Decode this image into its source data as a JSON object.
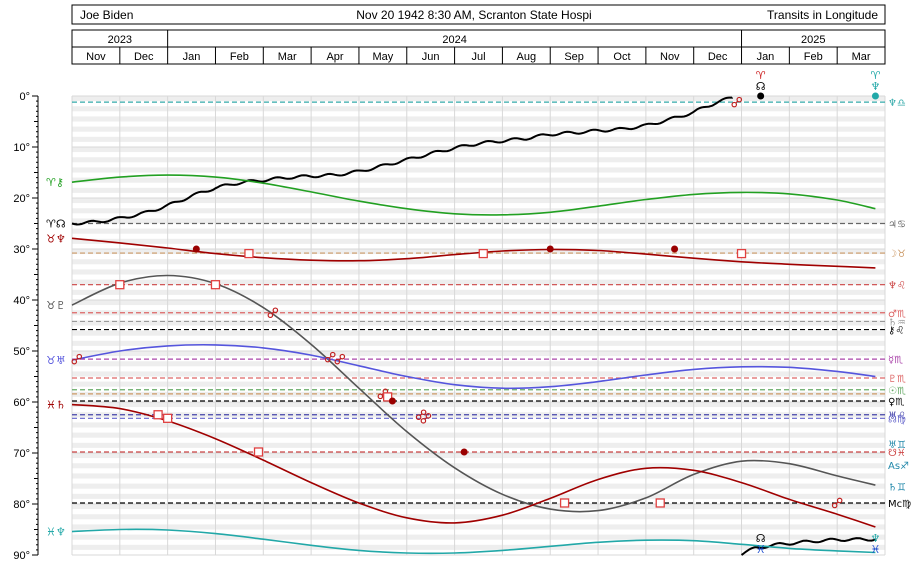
{
  "header": {
    "person": "Joe Biden",
    "event": "Nov 20 1942 8:30 AM, Scranton State Hospi",
    "mode": "Transits in Longitude"
  },
  "colors": {
    "grid_shade": "#eeeeee",
    "grid_line": "#d8d8d8",
    "axis": "#000000",
    "aspect_square": "#e04040",
    "aspect_trine": "#9a0000",
    "aspect_opposition": "#c02020"
  },
  "chart_data": {
    "type": "line",
    "title": "",
    "xlabel": "",
    "ylabel": "",
    "ylim": [
      0,
      90
    ],
    "grid": true,
    "y_ticks": [
      "0°",
      "10°",
      "20°",
      "30°",
      "40°",
      "50°",
      "60°",
      "70°",
      "80°",
      "90°"
    ],
    "years": [
      {
        "label": "2023",
        "start": 0,
        "end": 2
      },
      {
        "label": "2024",
        "start": 2,
        "end": 14
      },
      {
        "label": "2025",
        "start": 14,
        "end": 17
      }
    ],
    "months": [
      "Nov",
      "Dec",
      "Jan",
      "Feb",
      "Mar",
      "Apr",
      "May",
      "Jun",
      "Jul",
      "Aug",
      "Sep",
      "Oct",
      "Nov",
      "Dec",
      "Jan",
      "Feb",
      "Mar"
    ],
    "series": [
      {
        "name": "Node",
        "color": "#000000",
        "x": [
          0,
          0.5,
          1,
          1.5,
          2,
          2.5,
          3,
          3.5,
          4,
          4.5,
          5,
          5.5,
          6,
          6.5,
          7,
          7.5,
          8,
          8.5,
          9,
          9.5,
          10,
          10.5,
          11,
          11.5,
          12,
          12.5,
          13,
          13.2,
          13.5,
          13.8
        ],
        "y": [
          25,
          24.7,
          24,
          23,
          21.5,
          19.6,
          18,
          17,
          16.5,
          16,
          15.7,
          15.5,
          14.8,
          13.7,
          12.5,
          11.3,
          10.2,
          9.3,
          8.8,
          8.3,
          7.5,
          7.2,
          6.8,
          6.5,
          5.8,
          4.6,
          3.2,
          2.3,
          1.2,
          0.3
        ],
        "wiggle": true
      },
      {
        "name": "Node",
        "color": "#000000",
        "x": [
          14,
          14.3,
          14.8,
          15.5,
          16,
          16.8
        ],
        "y": [
          89.8,
          88.6,
          87.9,
          87.3,
          87.0,
          86.9
        ],
        "wiggle": true
      },
      {
        "name": "Chiron",
        "color": "#22a022",
        "x": [
          0,
          1,
          2,
          3,
          4,
          5,
          6,
          7,
          8,
          9,
          10,
          11,
          12,
          13,
          14,
          15,
          16,
          16.8
        ],
        "y": [
          16.9,
          15.9,
          15.5,
          15.9,
          17.1,
          18.8,
          20.6,
          22.1,
          23.1,
          23.3,
          22.8,
          21.6,
          20.3,
          19.3,
          18.9,
          19.2,
          20.4,
          22.1
        ]
      },
      {
        "name": "Neptune",
        "color": "#a00000",
        "x": [
          0,
          1,
          2,
          3,
          4,
          5,
          6,
          7,
          8,
          9,
          10,
          11,
          12,
          13,
          14,
          15,
          16,
          16.8
        ],
        "y": [
          27.9,
          28.8,
          29.8,
          30.9,
          31.7,
          32.2,
          32.3,
          31.9,
          31.1,
          30.4,
          30.1,
          30.3,
          31.0,
          31.8,
          32.5,
          33.0,
          33.4,
          33.7
        ]
      },
      {
        "name": "Pluto",
        "color": "#555555",
        "x": [
          0,
          1,
          2,
          3,
          4,
          5,
          6,
          7,
          8,
          9,
          10,
          11,
          12,
          13,
          14,
          15,
          16,
          16.8
        ],
        "y": [
          41,
          36.7,
          35.2,
          36.8,
          41.5,
          48.7,
          57.3,
          65.8,
          72.9,
          78.1,
          81.0,
          81.3,
          78.8,
          74.2,
          71.6,
          72.1,
          74.5,
          76.3
        ]
      },
      {
        "name": "Uranus",
        "color": "#5555dd",
        "x": [
          0,
          1,
          2,
          3,
          4,
          5,
          6,
          7,
          8,
          9,
          10,
          11,
          12,
          13,
          14,
          15,
          16,
          16.8
        ],
        "y": [
          51.8,
          50,
          49,
          48.8,
          49.4,
          50.8,
          52.9,
          55.0,
          56.6,
          57.3,
          57.0,
          56.0,
          54.7,
          53.6,
          53.1,
          53.2,
          54.0,
          55.0
        ]
      },
      {
        "name": "Saturn",
        "color": "#a00000",
        "x": [
          0,
          1,
          2,
          3,
          4,
          5,
          6,
          7,
          8,
          9,
          10,
          11,
          12,
          13,
          14,
          15,
          16,
          16.8
        ],
        "y": [
          60.5,
          61.3,
          63.7,
          67.2,
          71.4,
          75.8,
          79.8,
          82.7,
          83.7,
          82.2,
          78.9,
          75.2,
          73.0,
          73.4,
          75.8,
          79.1,
          82.0,
          84.5
        ]
      },
      {
        "name": "Neptune",
        "color": "#22a8a8",
        "x": [
          0,
          1,
          2,
          3,
          4,
          5,
          6,
          7,
          8,
          9,
          10,
          11,
          12,
          13,
          14,
          15,
          16,
          16.8
        ],
        "y": [
          85.4,
          85.0,
          85.1,
          85.8,
          86.9,
          88.1,
          89.1,
          89.6,
          89.6,
          89.1,
          88.3,
          87.5,
          87.1,
          87.2,
          87.9,
          88.7,
          89.2,
          89.5
        ]
      }
    ],
    "natal_lines": [
      {
        "y": 1.2,
        "color": "#33aaaa",
        "glyphs": "♆♎"
      },
      {
        "y": 25.0,
        "color": "#666666",
        "glyphs": "♃♋"
      },
      {
        "y": 30.8,
        "color": "#cc9966",
        "glyphs": "☽♉"
      },
      {
        "y": 37.0,
        "color": "#cc4444",
        "glyphs": "♆♌"
      },
      {
        "y": 42.5,
        "color": "#dd6666",
        "glyphs": "♂♏"
      },
      {
        "y": 44.2,
        "color": "#999999",
        "glyphs": "♄♒"
      },
      {
        "y": 45.8,
        "color": "#000000",
        "glyphs": "⚷♌"
      },
      {
        "y": 51.6,
        "color": "#aa44aa",
        "glyphs": "☿♏"
      },
      {
        "y": 55.3,
        "color": "#dd6666",
        "glyphs": "♇♏"
      },
      {
        "y": 57.6,
        "color": "#66aa66",
        "glyphs": "☉♏"
      },
      {
        "y": 58.4,
        "color": "#cc9966",
        "glyphs": ""
      },
      {
        "y": 59.8,
        "color": "#000000",
        "glyphs": "♀♏"
      },
      {
        "y": 62.5,
        "color": "#4444aa",
        "glyphs": "♅♌"
      },
      {
        "y": 63.2,
        "color": "#6666cc",
        "glyphs": "☊♍"
      },
      {
        "y": 69.8,
        "color": "#cc4444",
        "glyphs": "☋♓"
      },
      {
        "y": 79.8,
        "color": "#000000",
        "glyphs": "Mc♍"
      }
    ],
    "right_labels": [
      "♆♎",
      "♃♋",
      "☽♉",
      "♆♌",
      "♂♏",
      "♄♒",
      "⚷♌",
      "☿♏",
      "♇♏",
      "☉♏",
      "♀♏",
      "♅♌",
      "☊♍",
      "☋♓",
      "♅♊",
      "As♐",
      "♄♊",
      "Mc♍"
    ],
    "left_labels": [
      {
        "y": 16.9,
        "text": "♈⚷",
        "color": "#22a022"
      },
      {
        "y": 25.0,
        "text": "♈☊",
        "color": "#000000"
      },
      {
        "y": 27.9,
        "text": "♉♆",
        "color": "#a00000"
      },
      {
        "y": 41.0,
        "text": "♉♇",
        "color": "#555555"
      },
      {
        "y": 51.8,
        "text": "♉♅",
        "color": "#5555dd"
      },
      {
        "y": 60.5,
        "text": "♓♄",
        "color": "#a00000"
      },
      {
        "y": 85.4,
        "text": "♓♆",
        "color": "#22a8a8"
      }
    ],
    "top_markers": [
      {
        "x": 14.4,
        "sign": "♈",
        "planet": "☊",
        "color": "#000000"
      },
      {
        "x": 16.8,
        "sign": "♈",
        "planet": "♆",
        "color": "#22a8a8"
      }
    ],
    "bottom_markers": [
      {
        "x": 14.4,
        "planet": "☊",
        "sign": "♓",
        "color": "#000000"
      },
      {
        "x": 16.8,
        "planet": "♆",
        "sign": "♓",
        "color": "#22a8a8"
      }
    ],
    "aspects": [
      {
        "x": 2.6,
        "y": 30.0,
        "kind": "trine"
      },
      {
        "x": 3.7,
        "y": 30.9,
        "kind": "square"
      },
      {
        "x": 8.6,
        "y": 30.9,
        "kind": "square"
      },
      {
        "x": 10.0,
        "y": 30.0,
        "kind": "trine"
      },
      {
        "x": 12.6,
        "y": 30.0,
        "kind": "trine"
      },
      {
        "x": 14.0,
        "y": 30.9,
        "kind": "square"
      },
      {
        "x": 1.0,
        "y": 37.0,
        "kind": "square"
      },
      {
        "x": 3.0,
        "y": 37.0,
        "kind": "square"
      },
      {
        "x": 4.2,
        "y": 42.5,
        "kind": "opposition"
      },
      {
        "x": 0.1,
        "y": 51.6,
        "kind": "opposition"
      },
      {
        "x": 5.4,
        "y": 51.2,
        "kind": "opposition"
      },
      {
        "x": 5.6,
        "y": 51.6,
        "kind": "opposition"
      },
      {
        "x": 6.5,
        "y": 58.4,
        "kind": "opposition"
      },
      {
        "x": 6.6,
        "y": 59.0,
        "kind": "square"
      },
      {
        "x": 6.7,
        "y": 59.8,
        "kind": "trine"
      },
      {
        "x": 7.3,
        "y": 62.5,
        "kind": "opposition"
      },
      {
        "x": 7.4,
        "y": 63.2,
        "kind": "opposition"
      },
      {
        "x": 1.8,
        "y": 62.5,
        "kind": "square"
      },
      {
        "x": 2.0,
        "y": 63.2,
        "kind": "square"
      },
      {
        "x": 3.9,
        "y": 69.8,
        "kind": "square"
      },
      {
        "x": 8.2,
        "y": 69.8,
        "kind": "trine"
      },
      {
        "x": 10.3,
        "y": 79.8,
        "kind": "square"
      },
      {
        "x": 12.3,
        "y": 79.8,
        "kind": "square"
      },
      {
        "x": 16.0,
        "y": 79.8,
        "kind": "opposition"
      },
      {
        "x": 13.9,
        "y": 1.2,
        "kind": "opposition"
      }
    ]
  }
}
